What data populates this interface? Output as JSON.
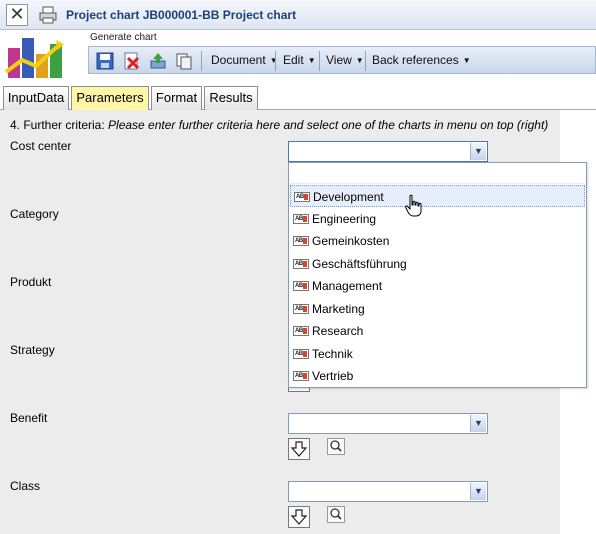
{
  "window": {
    "title": "Project chart JB000001-BB Project chart"
  },
  "header": {
    "generate_label": "Generate chart"
  },
  "menus": {
    "document": "Document",
    "edit": "Edit",
    "view": "View",
    "back_references": "Back references"
  },
  "tabs": [
    {
      "label": "InputData",
      "active": false
    },
    {
      "label": "Parameters",
      "active": true
    },
    {
      "label": "Format",
      "active": false
    },
    {
      "label": "Results",
      "active": false
    }
  ],
  "form": {
    "intro_prefix": "4. Further criteria: ",
    "intro_italic": "Please enter further criteria here and select one of the charts in menu on top (right)",
    "fields": {
      "cost_center": {
        "label": "Cost center",
        "value": ""
      },
      "category": {
        "label": "Category"
      },
      "produkt": {
        "label": "Produkt"
      },
      "strategy": {
        "label": "Strategy"
      },
      "benefit": {
        "label": "Benefit",
        "value": ""
      },
      "class": {
        "label": "Class",
        "value": ""
      }
    }
  },
  "dropdown": {
    "options": [
      "Development",
      "Engineering",
      "Gemeinkosten",
      "Geschäftsführung",
      "Management",
      "Marketing",
      "Research",
      "Technik",
      "Vertrieb"
    ],
    "hovered": "Development"
  },
  "colors": {
    "title_text": "#1e3f7a",
    "active_tab": "#fff7a8",
    "content_bg": "#ececec"
  }
}
